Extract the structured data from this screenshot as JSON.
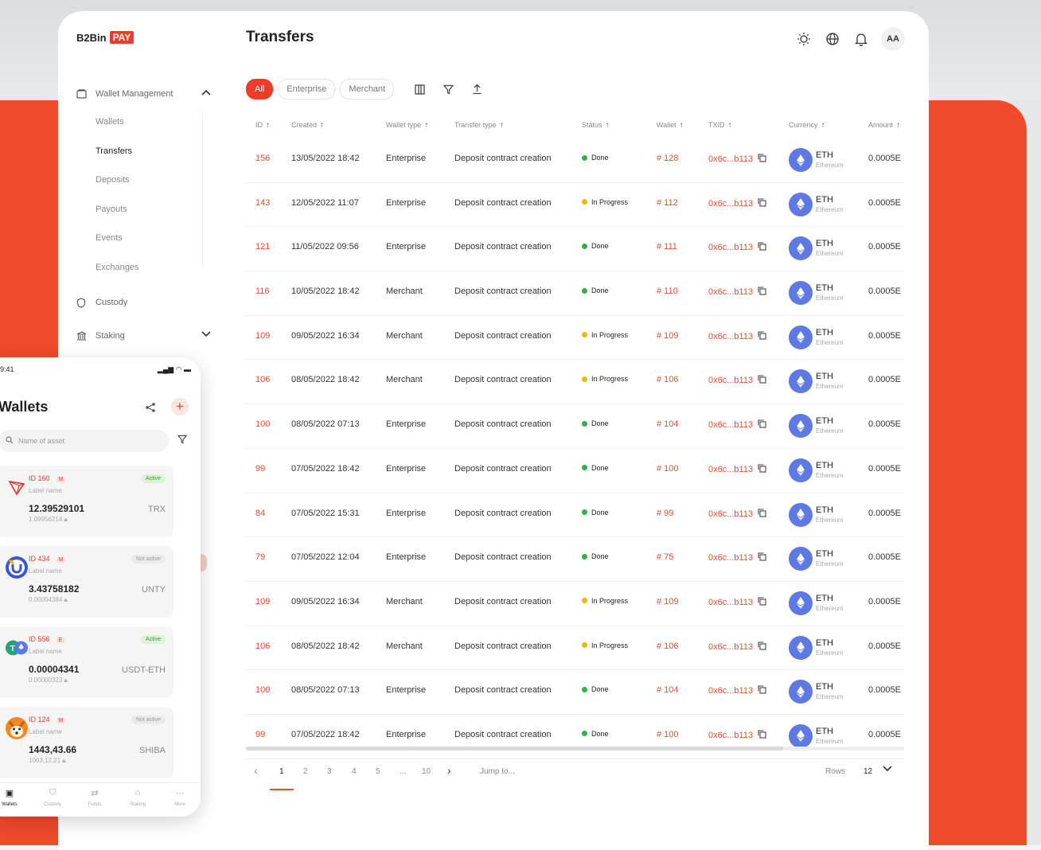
{
  "logo": {
    "name": "B2Bin",
    "badge": "PAY"
  },
  "sidebar": {
    "group_wallet": "Wallet Management",
    "sub_items": [
      "Wallets",
      "Transfers",
      "Deposits",
      "Payouts",
      "Events",
      "Exchanges"
    ],
    "active_item": "Transfers",
    "custody": "Custody",
    "staking": "Staking"
  },
  "header": {
    "title": "Transfers",
    "avatar": "AA"
  },
  "filters": {
    "all": "All",
    "enterprise": "Enterprise",
    "merchant": "Merchant"
  },
  "table": {
    "columns": [
      "ID",
      "Created",
      "Wallet type",
      "Transfer type",
      "Status",
      "Wallet",
      "TXID",
      "Currency",
      "Amount"
    ],
    "rows": [
      {
        "id": "156",
        "created": "13/05/2022 18:42",
        "wallet_type": "Enterprise",
        "transfer_type": "Deposit contract creation",
        "status": "Done",
        "wallet": "# 128",
        "txid": "0x6c...b113",
        "currency": "ETH",
        "network": "Ethereum",
        "amount": "0.0005E"
      },
      {
        "id": "143",
        "created": "12/05/2022 11:07",
        "wallet_type": "Enterprise",
        "transfer_type": "Deposit contract creation",
        "status": "In Progress",
        "wallet": "# 112",
        "txid": "0x6c...b113",
        "currency": "ETH",
        "network": "Ethereum",
        "amount": "0.0005E"
      },
      {
        "id": "121",
        "created": "11/05/2022 09:56",
        "wallet_type": "Enterprise",
        "transfer_type": "Deposit contract creation",
        "status": "Done",
        "wallet": "# 111",
        "txid": "0x6c...b113",
        "currency": "ETH",
        "network": "Ethereum",
        "amount": "0.0005E"
      },
      {
        "id": "116",
        "created": "10/05/2022 18:42",
        "wallet_type": "Merchant",
        "transfer_type": "Deposit contract creation",
        "status": "Done",
        "wallet": "# 110",
        "txid": "0x6c...b113",
        "currency": "ETH",
        "network": "Ethereum",
        "amount": "0.0005E"
      },
      {
        "id": "109",
        "created": "09/05/2022 16:34",
        "wallet_type": "Merchant",
        "transfer_type": "Deposit contract creation",
        "status": "In Progress",
        "wallet": "# 109",
        "txid": "0x6c...b113",
        "currency": "ETH",
        "network": "Ethereum",
        "amount": "0.0005E"
      },
      {
        "id": "106",
        "created": "08/05/2022 18:42",
        "wallet_type": "Merchant",
        "transfer_type": "Deposit contract creation",
        "status": "In Progress",
        "wallet": "# 106",
        "txid": "0x6c...b113",
        "currency": "ETH",
        "network": "Ethereum",
        "amount": "0.0005E"
      },
      {
        "id": "100",
        "created": "08/05/2022 07:13",
        "wallet_type": "Enterprise",
        "transfer_type": "Deposit contract creation",
        "status": "Done",
        "wallet": "# 104",
        "txid": "0x6c...b113",
        "currency": "ETH",
        "network": "Ethereum",
        "amount": "0.0005E"
      },
      {
        "id": "99",
        "created": "07/05/2022 18:42",
        "wallet_type": "Enterprise",
        "transfer_type": "Deposit contract creation",
        "status": "Done",
        "wallet": "# 100",
        "txid": "0x6c...b113",
        "currency": "ETH",
        "network": "Ethereum",
        "amount": "0.0005E"
      },
      {
        "id": "84",
        "created": "07/05/2022 15:31",
        "wallet_type": "Enterprise",
        "transfer_type": "Deposit contract creation",
        "status": "Done",
        "wallet": "# 99",
        "txid": "0x6c...b113",
        "currency": "ETH",
        "network": "Ethereum",
        "amount": "0.0005E"
      },
      {
        "id": "79",
        "created": "07/05/2022 12:04",
        "wallet_type": "Enterprise",
        "transfer_type": "Deposit contract creation",
        "status": "Done",
        "wallet": "# 75",
        "txid": "0x6c...b113",
        "currency": "ETH",
        "network": "Ethereum",
        "amount": "0.0005E"
      },
      {
        "id": "109",
        "created": "09/05/2022 16:34",
        "wallet_type": "Merchant",
        "transfer_type": "Deposit contract creation",
        "status": "In Progress",
        "wallet": "# 109",
        "txid": "0x6c...b113",
        "currency": "ETH",
        "network": "Ethereum",
        "amount": "0.0005E"
      },
      {
        "id": "106",
        "created": "08/05/2022 18:42",
        "wallet_type": "Merchant",
        "transfer_type": "Deposit contract creation",
        "status": "In Progress",
        "wallet": "# 106",
        "txid": "0x6c...b113",
        "currency": "ETH",
        "network": "Ethereum",
        "amount": "0.0005E"
      },
      {
        "id": "100",
        "created": "08/05/2022 07:13",
        "wallet_type": "Enterprise",
        "transfer_type": "Deposit contract creation",
        "status": "Done",
        "wallet": "# 104",
        "txid": "0x6c...b113",
        "currency": "ETH",
        "network": "Ethereum",
        "amount": "0.0005E"
      },
      {
        "id": "99",
        "created": "07/05/2022 18:42",
        "wallet_type": "Enterprise",
        "transfer_type": "Deposit contract creation",
        "status": "Done",
        "wallet": "# 100",
        "txid": "0x6c...b113",
        "currency": "ETH",
        "network": "Ethereum",
        "amount": "0.0005E"
      }
    ]
  },
  "pagination": {
    "pages": [
      "1",
      "2",
      "3",
      "4",
      "5",
      "...",
      "10"
    ],
    "current": "1",
    "jump": "Jump to...",
    "rows_label": "Rows",
    "rows_value": "12"
  },
  "mobile": {
    "time": "9:41",
    "title": "Wallets",
    "search_placeholder": "Name of asset",
    "cards": [
      {
        "id": "ID 160",
        "tag": "M",
        "label": "Label name",
        "status": "Active",
        "balance": "12.39529101",
        "sub": "1.09956214",
        "symbol": "TRX",
        "icon": "tron-icon"
      },
      {
        "id": "ID 434",
        "tag": "M",
        "label": "Label name",
        "status": "Not active",
        "balance": "3.43758182",
        "sub": "0.00004384",
        "symbol": "UNTY",
        "icon": "unity-icon"
      },
      {
        "id": "ID 556",
        "tag": "E",
        "label": "Label name",
        "status": "Active",
        "balance": "0.00004341",
        "sub": "0.00000323",
        "symbol": "USDT-ETH",
        "icon": "usdt-eth-icon"
      },
      {
        "id": "ID 124",
        "tag": "M",
        "label": "Label name",
        "status": "Not active",
        "balance": "1443,43.66",
        "sub": "1003,12.21",
        "symbol": "SHIBA",
        "icon": "shiba-icon"
      }
    ],
    "tabs": [
      "Wallets",
      "Custody",
      "Funds",
      "Staking",
      "More"
    ]
  },
  "colors": {
    "accent": "#ef3b2a",
    "done": "#2fb344",
    "progress": "#f2b705",
    "eth": "#5e79e4"
  }
}
